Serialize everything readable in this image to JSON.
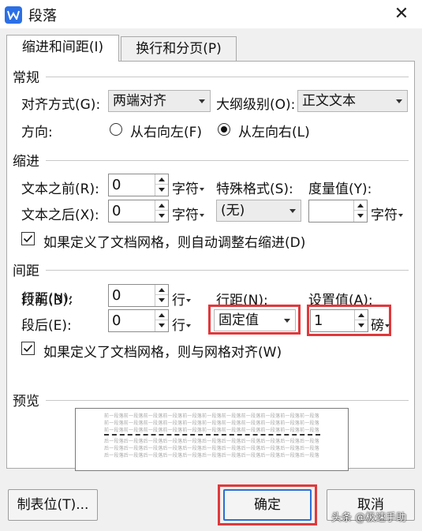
{
  "window": {
    "title": "段落",
    "close_symbol": "✕"
  },
  "tabs": [
    {
      "label": "缩进和间距(I)",
      "active": true
    },
    {
      "label": "换行和分页(P)",
      "active": false
    }
  ],
  "general": {
    "heading": "常规",
    "alignment_label": "对齐方式(G):",
    "alignment_value": "两端对齐",
    "outline_label": "大纲级别(O):",
    "outline_value": "正文文本",
    "direction_label": "方向:",
    "direction_rtl": "从右向左(F)",
    "direction_ltr": "从左向右(L)",
    "direction_selected": "ltr"
  },
  "indent": {
    "heading": "缩进",
    "before_label": "文本之前(R):",
    "before_value": "0",
    "before_unit": "字符",
    "after_label": "文本之后(X):",
    "after_value": "0",
    "after_unit": "字符",
    "special_label": "特殊格式(S):",
    "special_value": "(无)",
    "measure_label": "度量值(Y):",
    "measure_value": "",
    "measure_unit": "字符",
    "auto_adjust_label": "如果定义了文档网格，则自动调整右缩进(D)",
    "auto_adjust_checked": true
  },
  "spacing": {
    "heading": "间距",
    "before_label": "段前(B):",
    "before_value": "0",
    "before_unit": "行",
    "after_label": "段后(E):",
    "after_value": "0",
    "after_unit": "行",
    "line_spacing_label": "行距(N):",
    "line_spacing_value": "固定值",
    "setting_label": "设置值(A):",
    "setting_value": "1",
    "setting_unit": "磅",
    "grid_align_label": "如果定义了文档网格，则与网格对齐(W)",
    "grid_align_checked": true
  },
  "preview": {
    "heading": "预览",
    "prev_text": "前一段落前一段落前一段落前一段落前一段落前一段落前一段落前一段落前一段落前一段落前一段落",
    "next_text": "后一段落后一段落后一段落后一段落后一段落后一段落后一段落后一段落后一段落后一段落后一段落"
  },
  "buttons": {
    "tabs_label": "制表位(T)...",
    "ok_label": "确定",
    "cancel_label": "取消"
  },
  "watermark": "头条 @极速手助",
  "colors": {
    "highlight": "#e0383b",
    "app_icon": "#2b6fe6"
  }
}
